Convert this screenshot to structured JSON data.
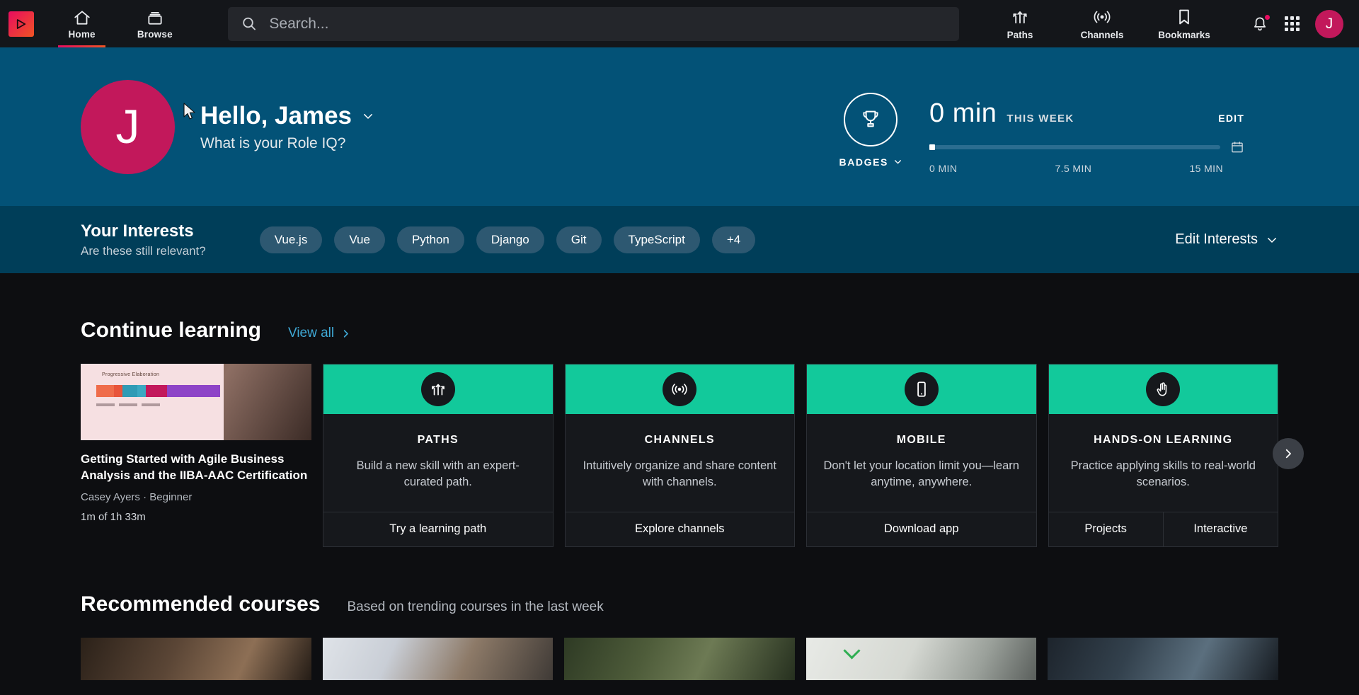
{
  "header": {
    "logo": "pluralsight-logo",
    "nav": [
      {
        "label": "Home",
        "icon": "home-icon",
        "active": true
      },
      {
        "label": "Browse",
        "icon": "browse-icon",
        "active": false
      }
    ],
    "search": {
      "placeholder": "Search...",
      "value": "",
      "icon": "search-icon"
    },
    "utility": [
      {
        "label": "Paths",
        "icon": "paths-icon"
      },
      {
        "label": "Channels",
        "icon": "channels-icon"
      },
      {
        "label": "Bookmarks",
        "icon": "bookmark-icon"
      }
    ],
    "notifications_icon": "bell-icon",
    "apps_icon": "grid-apps-icon",
    "avatar_initial": "J"
  },
  "hero": {
    "avatar_initial": "J",
    "greeting": "Hello, James",
    "role_iq": "What is your Role IQ?",
    "badges_label": "BADGES",
    "badges_icon": "trophy-icon",
    "stats": {
      "value": "0 min",
      "period": "THIS WEEK",
      "edit_label": "EDIT",
      "calendar_icon": "calendar-icon",
      "axis": [
        "0 MIN",
        "7.5 MIN",
        "15 MIN"
      ],
      "progress_percent": 0
    },
    "bg_color": "#035277"
  },
  "interests": {
    "title": "Your Interests",
    "subtitle": "Are these still relevant?",
    "tags": [
      "Vue.js",
      "Vue",
      "Python",
      "Django",
      "Git",
      "TypeScript",
      "+4"
    ],
    "edit_label": "Edit Interests",
    "bg_color": "#003e59"
  },
  "continue_learning": {
    "title": "Continue learning",
    "view_all": "View all",
    "course": {
      "title": "Getting Started with Agile Business Analysis and the IIBA-AAC Certification",
      "author": "Casey Ayers",
      "level": "Beginner",
      "separator": "·",
      "progress": "1m of 1h 33m",
      "thumb_caption": "Progressive Elaboration"
    },
    "feature_cards": [
      {
        "name": "PATHS",
        "icon": "paths-icon",
        "description": "Build a new skill with an expert-curated path.",
        "actions": [
          "Try a learning path"
        ]
      },
      {
        "name": "CHANNELS",
        "icon": "channels-icon",
        "description": "Intuitively organize and share content with channels.",
        "actions": [
          "Explore channels"
        ]
      },
      {
        "name": "MOBILE",
        "icon": "mobile-icon",
        "description": "Don't let your location limit you—learn anytime, anywhere.",
        "actions": [
          "Download app"
        ]
      },
      {
        "name": "HANDS-ON LEARNING",
        "icon": "hands-on-icon",
        "description": "Practice applying skills to real-world scenarios.",
        "actions": [
          "Projects",
          "Interactive"
        ]
      }
    ],
    "accent_color": "#12c99b"
  },
  "recommended": {
    "title": "Recommended courses",
    "subtitle": "Based on trending courses in the last week"
  }
}
